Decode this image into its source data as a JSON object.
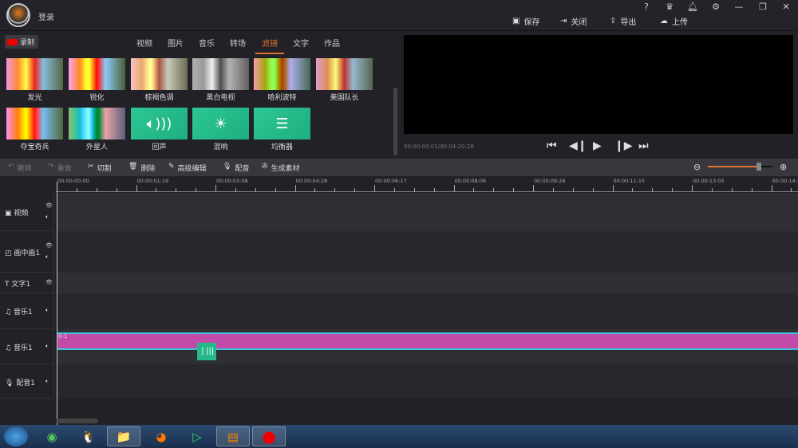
{
  "header": {
    "login": "登录",
    "window_buttons": [
      "?",
      "vip-crown",
      "qq-bell",
      "gear",
      "minimize",
      "restore",
      "close"
    ],
    "actions": [
      {
        "label": "保存",
        "icon": "save-icon"
      },
      {
        "label": "关闭",
        "icon": "exit-icon"
      },
      {
        "label": "导出",
        "icon": "export-icon"
      },
      {
        "label": "上传",
        "icon": "upload-icon"
      }
    ]
  },
  "library": {
    "record_label": "录制",
    "tabs": [
      "视频",
      "图片",
      "音乐",
      "转场",
      "滤镜",
      "文字",
      "作品"
    ],
    "active_tab": "滤镜",
    "filters": [
      "发光",
      "锐化",
      "棕褐色调",
      "黑白电视",
      "哈利波特",
      "美国队长",
      "夺宝奇兵",
      "外星人",
      "回声",
      "混响",
      "均衡器"
    ]
  },
  "preview": {
    "timecode": "00:00:00:01/00:04:20:28"
  },
  "toolbar": {
    "undo": "撤销",
    "redo": "重做",
    "cut": "切割",
    "delete": "删除",
    "advanced_edit": "高级编辑",
    "dub": "配音",
    "generate": "生成素材",
    "zoom_level": 0.8
  },
  "ruler": [
    "00:00:00:00",
    "00:00:01:19",
    "00:00:03:08",
    "00:00:04:28",
    "00:00:06:17",
    "00:00:08:06",
    "00:00:09:26",
    "00:00:11:15",
    "00:00:13:05",
    "00:00:14:2"
  ],
  "tracks": [
    "视频",
    "画中画1",
    "文字1",
    "音乐1",
    "音乐1",
    "配音1"
  ],
  "clip": {
    "label": "0-1",
    "color": "#c24aa8"
  },
  "colors": {
    "accent": "#e0742c",
    "filter_green": "#2cc794"
  }
}
